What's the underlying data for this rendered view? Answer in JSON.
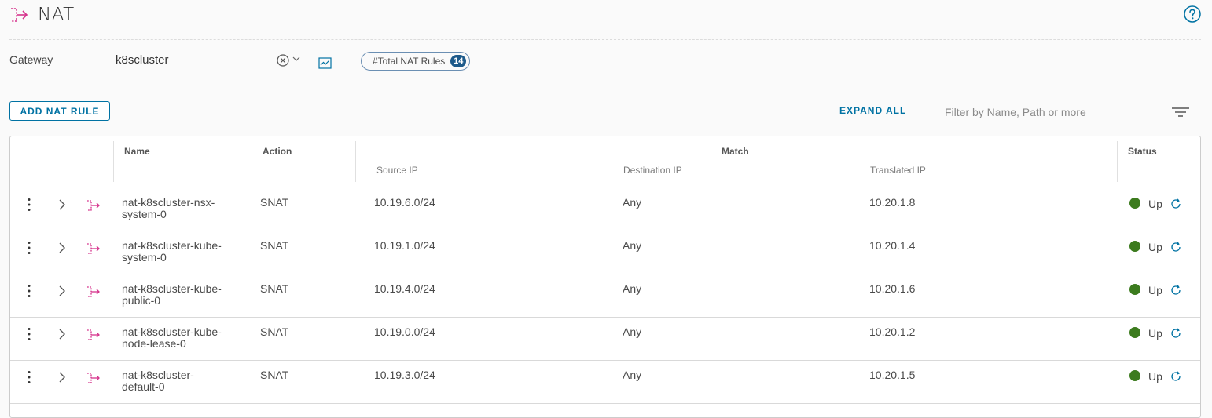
{
  "page": {
    "title": "NAT"
  },
  "gateway": {
    "label": "Gateway",
    "value": "k8scluster"
  },
  "total": {
    "label": "#Total NAT Rules",
    "count": "14"
  },
  "toolbar": {
    "add_label": "ADD NAT RULE",
    "expand_label": "EXPAND ALL",
    "filter_placeholder": "Filter by Name, Path or more"
  },
  "columns": {
    "name": "Name",
    "action": "Action",
    "match": "Match",
    "source_ip": "Source IP",
    "destination_ip": "Destination IP",
    "translated_ip": "Translated IP",
    "status": "Status"
  },
  "colors": {
    "accent": "#0072a3",
    "status_up": "#3c7b1e",
    "rule_icon": "#d6338c"
  },
  "rows": [
    {
      "name_line1": "nat-k8scluster-nsx-",
      "name_line2": "system-0",
      "action": "SNAT",
      "source_ip": "10.19.6.0/24",
      "destination_ip": "Any",
      "translated_ip": "10.20.1.8",
      "status": "Up"
    },
    {
      "name_line1": "nat-k8scluster-kube-",
      "name_line2": "system-0",
      "action": "SNAT",
      "source_ip": "10.19.1.0/24",
      "destination_ip": "Any",
      "translated_ip": "10.20.1.4",
      "status": "Up"
    },
    {
      "name_line1": "nat-k8scluster-kube-",
      "name_line2": "public-0",
      "action": "SNAT",
      "source_ip": "10.19.4.0/24",
      "destination_ip": "Any",
      "translated_ip": "10.20.1.6",
      "status": "Up"
    },
    {
      "name_line1": "nat-k8scluster-kube-",
      "name_line2": "node-lease-0",
      "action": "SNAT",
      "source_ip": "10.19.0.0/24",
      "destination_ip": "Any",
      "translated_ip": "10.20.1.2",
      "status": "Up"
    },
    {
      "name_line1": "nat-k8scluster-",
      "name_line2": "default-0",
      "action": "SNAT",
      "source_ip": "10.19.3.0/24",
      "destination_ip": "Any",
      "translated_ip": "10.20.1.5",
      "status": "Up"
    }
  ]
}
